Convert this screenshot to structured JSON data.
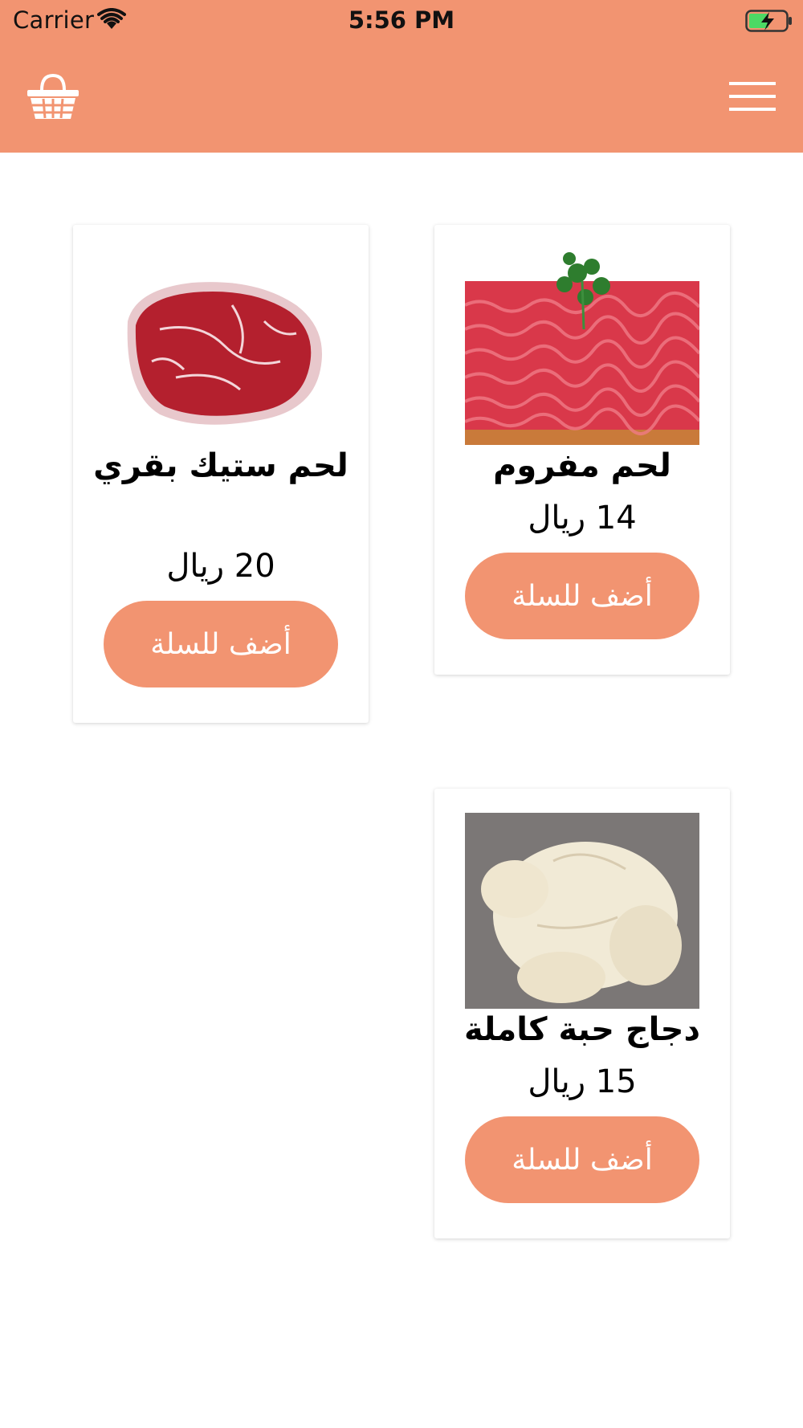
{
  "status_bar": {
    "carrier": "Carrier",
    "time": "5:56 PM",
    "wifi_icon": "wifi-icon",
    "battery_icon": "battery-charging-icon",
    "battery_color": "#4cd964"
  },
  "header": {
    "background": "#f29471",
    "cart_icon": "basket-icon",
    "menu_icon": "hamburger-menu-icon"
  },
  "products": [
    {
      "name": "لحم مفروم",
      "price": "14 ريال",
      "button_label": "أضف للسلة",
      "image": "minced-meat-image"
    },
    {
      "name": "لحم ستيك بقري",
      "price": "20 ريال",
      "button_label": "أضف للسلة",
      "image": "beef-steak-image"
    },
    {
      "name": "دجاج حبة كاملة",
      "price": "15 ريال",
      "button_label": "أضف للسلة",
      "image": "whole-chicken-image"
    }
  ],
  "accent_color": "#f29471"
}
